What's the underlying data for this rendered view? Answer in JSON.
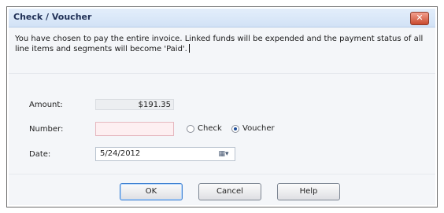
{
  "window": {
    "title": "Check / Voucher",
    "close_glyph": "✕"
  },
  "message": "You have chosen to pay the entire invoice. Linked funds will be expended and the payment status of all line items and segments will become 'Paid'.",
  "form": {
    "amount_label": "Amount:",
    "amount_value": "$191.35",
    "number_label": "Number:",
    "number_value": "",
    "check_label": "Check",
    "voucher_label": "Voucher",
    "selected_option": "Voucher",
    "date_label": "Date:",
    "date_value": "5/24/2012",
    "date_picker_glyph": "▦▾"
  },
  "buttons": {
    "ok": "OK",
    "cancel": "Cancel",
    "help": "Help"
  },
  "colors": {
    "titlebar": "#d2e2f6",
    "close_button": "#c94a2e",
    "number_field_background": "#fdeff1"
  }
}
